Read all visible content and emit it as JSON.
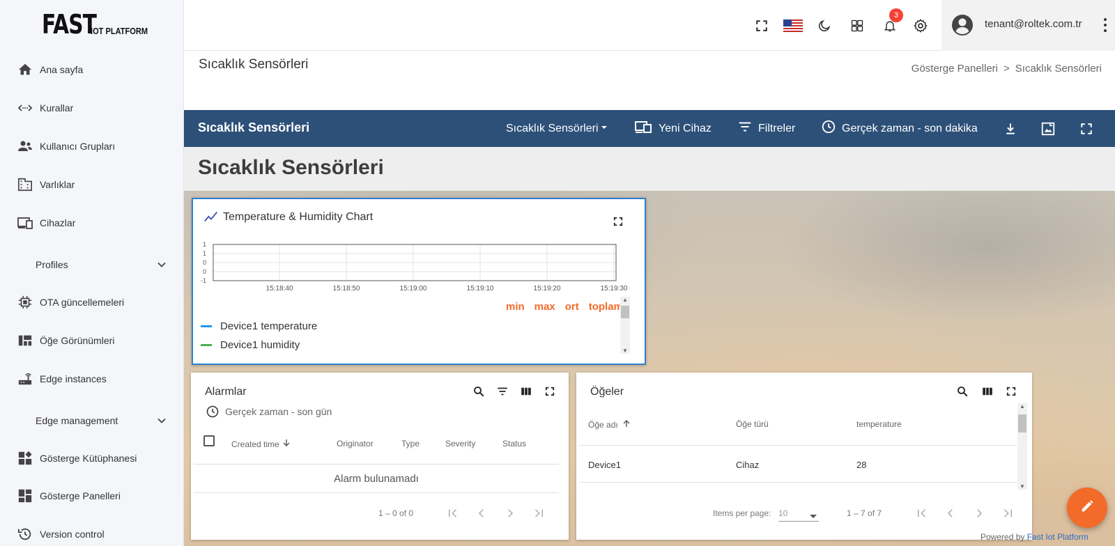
{
  "logo": {
    "big": "FAST",
    "small": "IOT PLATFORM"
  },
  "sidebar": {
    "items": [
      {
        "label": "Ana sayfa",
        "icon": "home-icon"
      },
      {
        "label": "Kurallar",
        "icon": "code-arrows-icon"
      },
      {
        "label": "Kullanıcı Grupları",
        "icon": "people-icon"
      },
      {
        "label": "Varlıklar",
        "icon": "building-icon"
      },
      {
        "label": "Cihazlar",
        "icon": "devices-icon"
      },
      {
        "label": "Profiles",
        "icon": "chevron-down-icon"
      },
      {
        "label": "OTA güncellemeleri",
        "icon": "chip-icon"
      },
      {
        "label": "Öğe Görünümleri",
        "icon": "view-quilt-icon"
      },
      {
        "label": "Edge instances",
        "icon": "router-icon"
      },
      {
        "label": "Edge management",
        "icon": "chevron-down-icon"
      },
      {
        "label": "Gösterge Kütüphanesi",
        "icon": "widgets-icon"
      },
      {
        "label": "Gösterge Panelleri",
        "icon": "dashboard-icon"
      },
      {
        "label": "Version control",
        "icon": "history-icon"
      }
    ]
  },
  "topbar": {
    "notification_count": "3",
    "user_email": "tenant@roltek.com.tr"
  },
  "page": {
    "title": "Sıcaklık Sensörleri",
    "breadcrumb": [
      "Gösterge Panelleri",
      ">",
      "Sıcaklık Sensörleri"
    ]
  },
  "dashboard": {
    "title": "Sıcaklık Sensörleri",
    "state_select": "Sıcaklık Sensörleri",
    "new_device": "Yeni Cihaz",
    "filters": "Filtreler",
    "timewindow": "Gerçek zaman - son dakika",
    "state_title": "Sıcaklık Sensörleri"
  },
  "chart_widget": {
    "title": "Temperature & Humidity Chart",
    "legend_headers": [
      "min",
      "max",
      "ort",
      "toplam"
    ],
    "legend_color": "#f26b2a"
  },
  "chart_data": {
    "type": "line",
    "title": "Temperature & Humidity Chart",
    "x_ticks": [
      "15:18:40",
      "15:18:50",
      "15:19:00",
      "15:19:10",
      "15:19:20",
      "15:19:30"
    ],
    "y_ticks": [
      "1",
      "1",
      "0",
      "0",
      "-1"
    ],
    "series": [
      {
        "name": "Device1 temperature",
        "color": "#2196f3",
        "values": []
      },
      {
        "name": "Device1 humidity",
        "color": "#4caf50",
        "values": []
      }
    ]
  },
  "alarms": {
    "title": "Alarmlar",
    "timewindow": "Gerçek zaman - son gün",
    "columns": [
      "Created time",
      "Originator",
      "Type",
      "Severity",
      "Status"
    ],
    "empty": "Alarm bulunamadı",
    "range": "1 – 0 of 0"
  },
  "entities": {
    "title": "Öğeler",
    "columns": [
      "Öğe adı",
      "Öğe türü",
      "temperature"
    ],
    "rows": [
      {
        "name": "Device1",
        "type": "Cihaz",
        "temperature": "28"
      }
    ],
    "items_per_page_label": "Items per page:",
    "items_per_page": "10",
    "range": "1 – 7 of 7"
  },
  "footer": {
    "powered_prefix": "Powered by",
    "powered_brand": "Fast Iot Platform"
  }
}
